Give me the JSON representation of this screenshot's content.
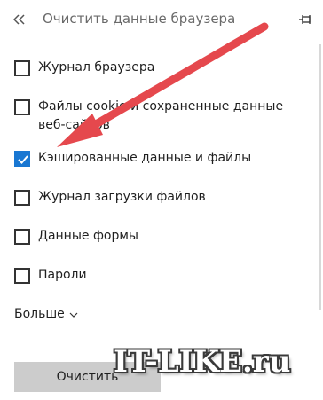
{
  "header": {
    "title": "Очистить данные браузера",
    "back_icon": "double-chevron-left-icon",
    "pin_icon": "pin-icon"
  },
  "options": [
    {
      "label": "Журнал браузера",
      "checked": false
    },
    {
      "label": "Файлы cookie и сохраненные данные веб-сайтов",
      "checked": false
    },
    {
      "label": "Кэшированные данные и файлы",
      "checked": true
    },
    {
      "label": "Журнал загрузки файлов",
      "checked": false
    },
    {
      "label": "Данные формы",
      "checked": false
    },
    {
      "label": "Пароли",
      "checked": false
    }
  ],
  "more_label": "Больше",
  "clear_button_label": "Очистить",
  "watermark": "IT-LIKE.ru",
  "colors": {
    "accent": "#1977d2",
    "arrow": "#e5484d",
    "button_bg": "#cccccc"
  }
}
